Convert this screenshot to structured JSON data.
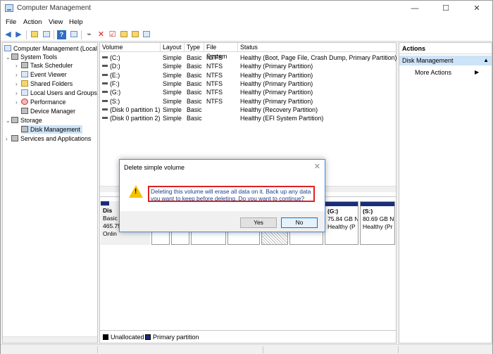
{
  "window": {
    "title": "Computer Management",
    "min": "—",
    "max": "☐",
    "close": "✕"
  },
  "menu": [
    "File",
    "Action",
    "View",
    "Help"
  ],
  "tree": {
    "root": "Computer Management (Local",
    "system_tools": "System Tools",
    "task_scheduler": "Task Scheduler",
    "event_viewer": "Event Viewer",
    "shared_folders": "Shared Folders",
    "local_users": "Local Users and Groups",
    "performance": "Performance",
    "device_manager": "Device Manager",
    "storage": "Storage",
    "disk_management": "Disk Management",
    "services": "Services and Applications"
  },
  "table": {
    "columns": [
      "Volume",
      "Layout",
      "Type",
      "File System",
      "Status"
    ],
    "rows": [
      [
        "(C:)",
        "Simple",
        "Basic",
        "NTFS",
        "Healthy (Boot, Page File, Crash Dump, Primary Partition)"
      ],
      [
        "(D:)",
        "Simple",
        "Basic",
        "NTFS",
        "Healthy (Primary Partition)"
      ],
      [
        "(E:)",
        "Simple",
        "Basic",
        "NTFS",
        "Healthy (Primary Partition)"
      ],
      [
        "(F:)",
        "Simple",
        "Basic",
        "NTFS",
        "Healthy (Primary Partition)"
      ],
      [
        "(G:)",
        "Simple",
        "Basic",
        "NTFS",
        "Healthy (Primary Partition)"
      ],
      [
        "(S:)",
        "Simple",
        "Basic",
        "NTFS",
        "Healthy (Primary Partition)"
      ],
      [
        "(Disk 0 partition 1)",
        "Simple",
        "Basic",
        "",
        "Healthy (Recovery Partition)"
      ],
      [
        "(Disk 0 partition 2)",
        "Simple",
        "Basic",
        "",
        "Healthy (EFI System Partition)"
      ]
    ]
  },
  "disk": {
    "label": "Dis",
    "type": "Basic",
    "size": "465.75",
    "status": "Onlin",
    "g_name": "(G:)",
    "g_size": "75.84 GB N",
    "g_status": "Healthy (P",
    "s_name": "(S:)",
    "s_size": "80.69 GB N",
    "s_status": "Healthy (Pr"
  },
  "legend": {
    "unallocated": "Unallocated",
    "primary": "Primary partition",
    "unalloc_color": "#000000",
    "primary_color": "#1b2e7a"
  },
  "actions": {
    "header": "Actions",
    "section": "Disk Management",
    "more": "More Actions"
  },
  "dialog": {
    "title": "Delete simple volume",
    "message_line1": "Deleting this volume will erase all data on it. Back up any data",
    "message_line2": "you want to keep before deleting. Do you want to continue?",
    "yes": "Yes",
    "no": "No",
    "highlight_color": "#dd2222"
  }
}
